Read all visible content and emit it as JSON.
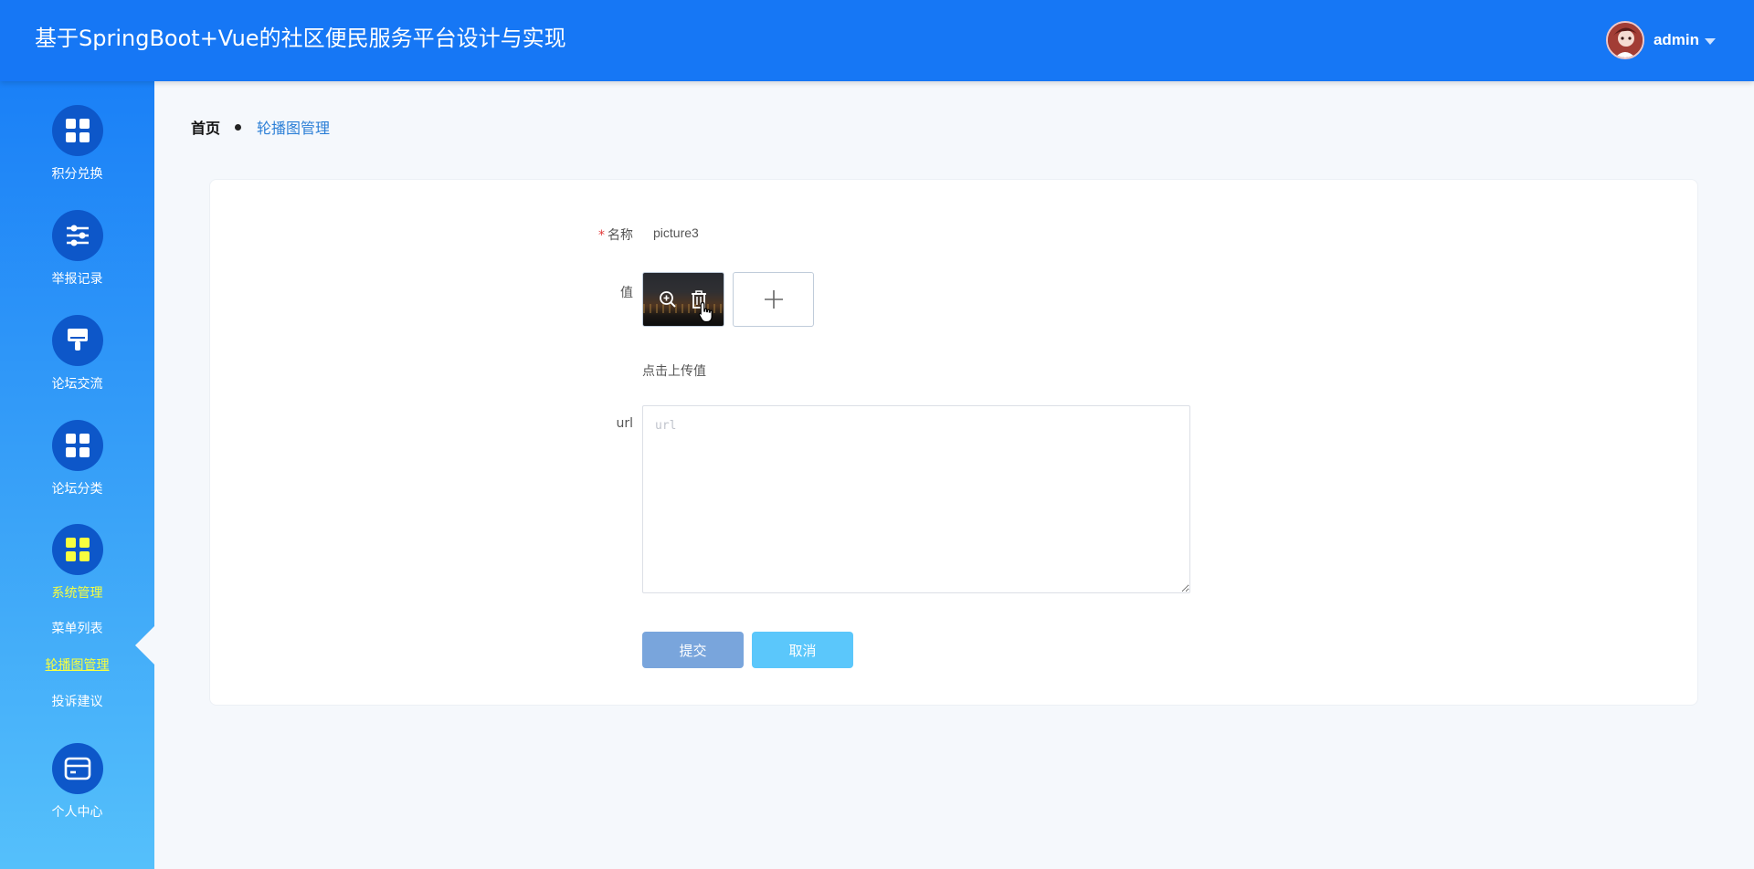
{
  "header": {
    "title": "基于SpringBoot+Vue的社区便民服务平台设计与实现",
    "username": "admin"
  },
  "sidebar": {
    "items": [
      {
        "label": "积分兑换",
        "icon": "grid-icon"
      },
      {
        "label": "举报记录",
        "icon": "sliders-icon"
      },
      {
        "label": "论坛交流",
        "icon": "brush-icon"
      },
      {
        "label": "论坛分类",
        "icon": "grid-icon"
      },
      {
        "label": "系统管理",
        "icon": "grid-icon",
        "active": true
      },
      {
        "label": "个人中心",
        "icon": "card-icon"
      }
    ],
    "submenu": [
      "菜单列表",
      "轮播图管理",
      "投诉建议"
    ],
    "active_submenu": "轮播图管理"
  },
  "breadcrumb": {
    "home": "首页",
    "current": "轮播图管理"
  },
  "form": {
    "name_label": "名称",
    "name_required_mark": "*",
    "name_value": "picture3",
    "value_label": "值",
    "upload_hint": "点击上传值",
    "url_label": "url",
    "url_placeholder": "url",
    "submit_label": "提交",
    "cancel_label": "取消"
  },
  "colors": {
    "header_bg": "#1677f5",
    "active_yellow": "#f8ff3f",
    "submit_bg": "#79a5dc",
    "cancel_bg": "#5bc7fb",
    "breadcrumb_link": "#2a7ed6"
  }
}
